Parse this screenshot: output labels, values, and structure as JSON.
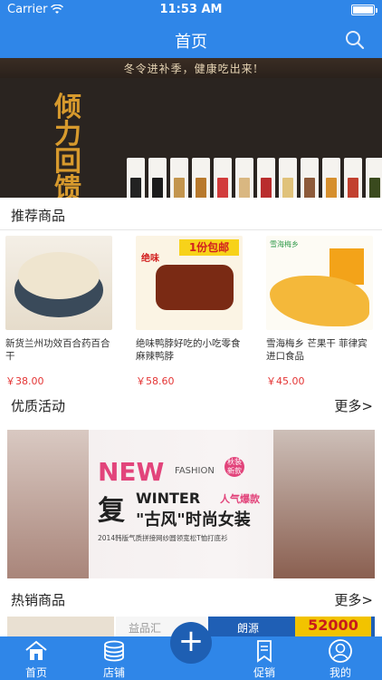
{
  "status": {
    "carrier": "Carrier",
    "time": "11:53 AM"
  },
  "nav": {
    "title": "首页"
  },
  "banner": {
    "slogan": "冬令进补季，健康吃出来!",
    "headline": [
      "倾",
      "力",
      "回",
      "馈"
    ]
  },
  "recommended": {
    "title": "推荐商品",
    "items": [
      {
        "name": "新货兰州功效百合药百合干",
        "price": "￥38.00"
      },
      {
        "name": "绝味鸭脖好吃的小吃零食麻辣鸭脖",
        "price": "￥58.60",
        "tag": "1份包邮",
        "brand": "绝味"
      },
      {
        "name": "雪海梅乡 芒果干 菲律宾进口食品",
        "price": "￥45.00",
        "brand": "雪海梅乡"
      }
    ]
  },
  "activity": {
    "title": "优质活动",
    "more": "更多>",
    "banner": {
      "new": "NEW",
      "fashion": "FASHION",
      "badge": "秋装新款",
      "fu": "复",
      "winter": "WINTER",
      "hot": "人气爆款",
      "style": "\"古风\"时尚女装",
      "sub": "2014韩版气质拼接网纱圆领宽松T恤打底衫"
    }
  },
  "hot": {
    "title": "热销商品",
    "more": "更多>",
    "strip": {
      "b": "益品汇",
      "c": "朗源",
      "c_num": "52000"
    }
  },
  "tabs": [
    {
      "label": "首页",
      "icon": "home-icon"
    },
    {
      "label": "店铺",
      "icon": "store-icon"
    },
    {
      "label": "促销",
      "icon": "bookmark-icon"
    },
    {
      "label": "我的",
      "icon": "user-icon"
    }
  ],
  "colors": {
    "primary": "#2f86e8",
    "price": "#e43535",
    "accent_pink": "#e2447b"
  }
}
